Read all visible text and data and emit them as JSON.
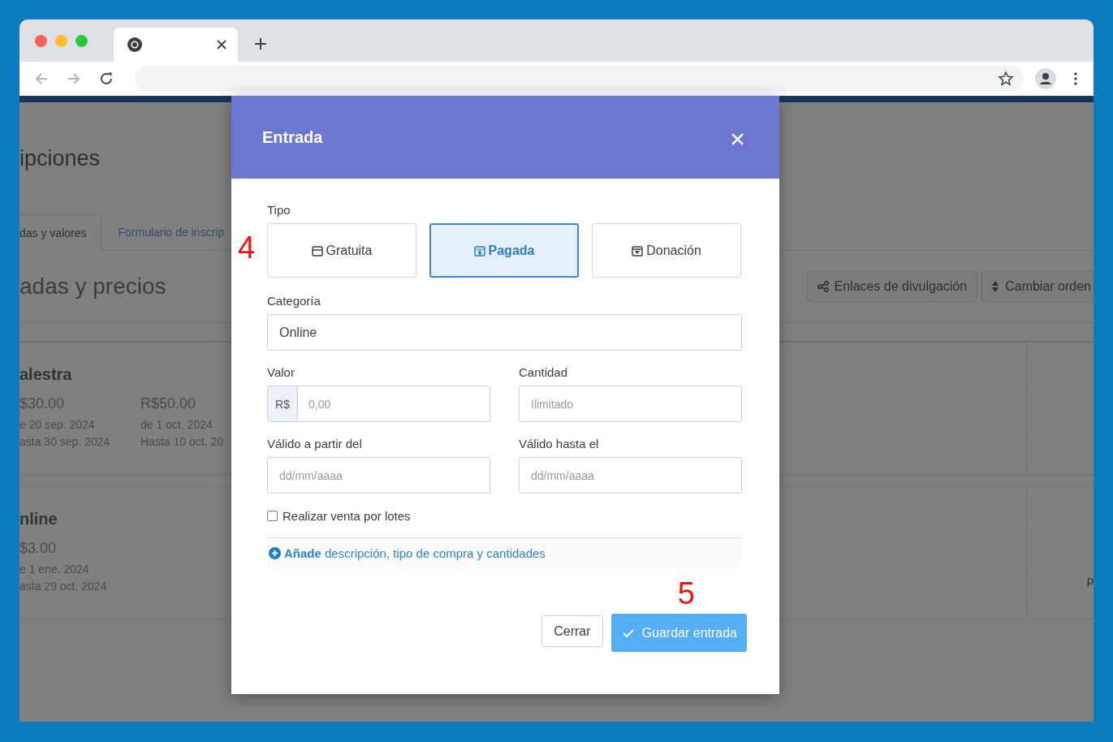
{
  "page": {
    "title": "ipciones",
    "tabs": [
      {
        "label": "das y valores",
        "selected": true
      },
      {
        "label": "Formulario de inscrip",
        "selected": false
      }
    ],
    "heading": "adas y precios",
    "actions": [
      {
        "kind": "share",
        "label": "Enlaces de divulgación"
      },
      {
        "kind": "sort",
        "label": "Cambiar orden"
      }
    ],
    "tickets": [
      {
        "name": "alestra",
        "prices": [
          {
            "price": "$30.00",
            "from": "e 20 sep. 2024",
            "to": "asta 30 sep. 2024"
          },
          {
            "price": "R$50.00",
            "from": "de 1 oct. 2024",
            "to": "Hasta 10 oct. 20"
          }
        ]
      },
      {
        "name": "nline",
        "prices": [
          {
            "price": "$3.00",
            "from": "e 1 ene. 2024",
            "to": "asta 29 oct. 2024"
          }
        ],
        "side_text": "p"
      }
    ]
  },
  "modal": {
    "title": "Entrada",
    "type_label": "Tipo",
    "types": [
      {
        "kind": "free",
        "label": "Gratuita",
        "selected": false
      },
      {
        "kind": "paid",
        "label": "Pagada",
        "selected": true
      },
      {
        "kind": "donation",
        "label": "Donación",
        "selected": false
      }
    ],
    "category": {
      "label": "Categoría",
      "value": "Online"
    },
    "price": {
      "label": "Valor",
      "prefix": "R$",
      "placeholder": "0,00"
    },
    "quantity": {
      "label": "Cantidad",
      "placeholder": "Ilimitado"
    },
    "valid_from": {
      "label": "Válido a partir del",
      "placeholder": "dd/mm/aaaa"
    },
    "valid_to": {
      "label": "Válido hasta el",
      "placeholder": "dd/mm/aaaa"
    },
    "batches": {
      "label": "Realizar venta por lotes",
      "checked": false
    },
    "more_link": "**Añade** descripción, tipo de compra y cantidades",
    "buttons": {
      "close": "Cerrar",
      "save": "Guardar entrada"
    }
  },
  "annotations": [
    "4",
    "5"
  ]
}
